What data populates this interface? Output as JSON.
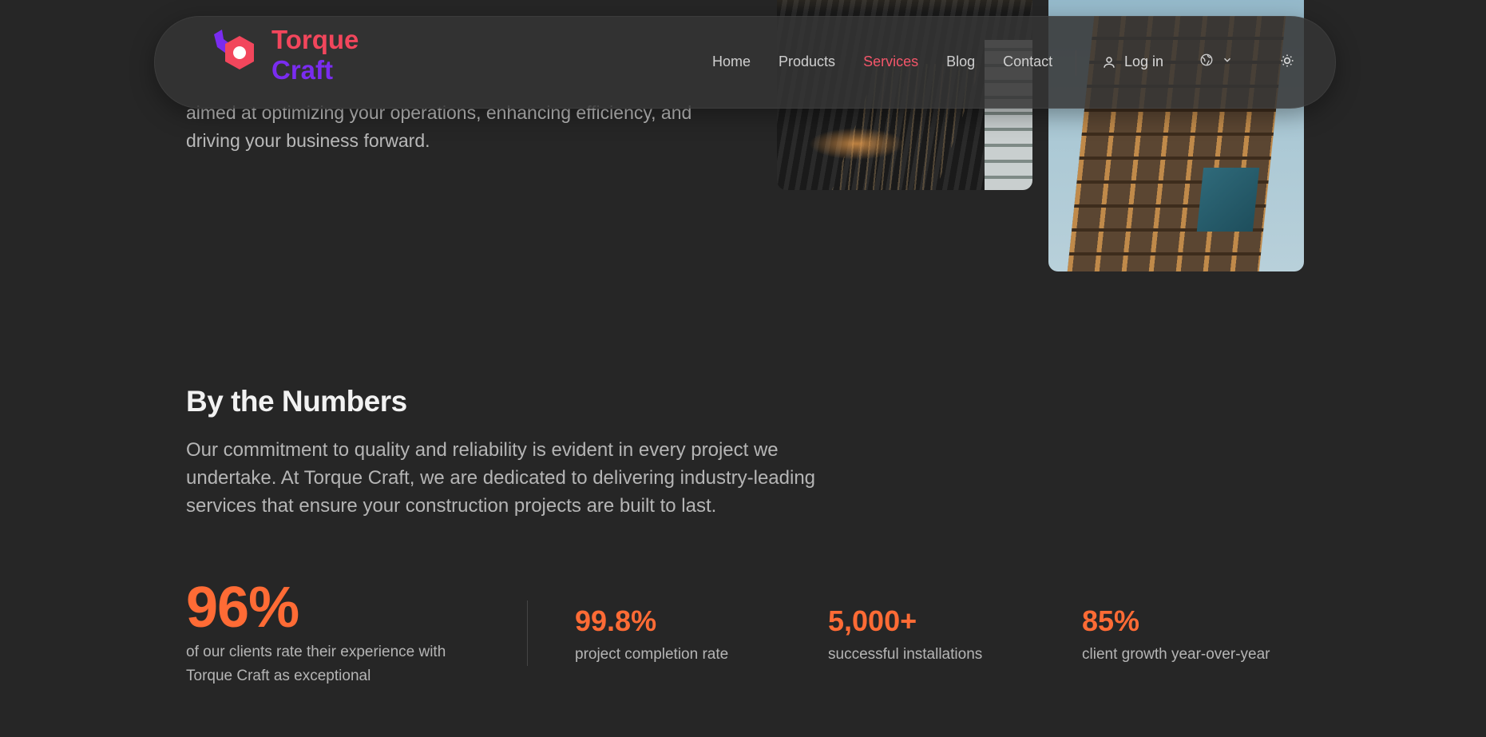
{
  "hero": {
    "description": "aimed at optimizing your operations, enhancing efficiency, and driving your business forward."
  },
  "brand": {
    "name_line1": "Torque",
    "name_line2": "Craft",
    "colors": {
      "primary": "#f2465c",
      "secondary": "#7a2cf0"
    }
  },
  "nav": {
    "links": [
      {
        "label": "Home",
        "active": false
      },
      {
        "label": "Products",
        "active": false
      },
      {
        "label": "Services",
        "active": true
      },
      {
        "label": "Blog",
        "active": false
      },
      {
        "label": "Contact",
        "active": false
      }
    ],
    "login_label": "Log in",
    "language_icon": "globe-icon",
    "theme_icon": "sun-icon"
  },
  "numbers": {
    "title": "By the Numbers",
    "description": "Our commitment to quality and reliability is evident in every project we undertake. At Torque Craft, we are dedicated to delivering industry-leading services that ensure your construction projects are built to last.",
    "featured": {
      "value": "96%",
      "label": "of our clients rate their experience with Torque Craft as exceptional"
    },
    "stats": [
      {
        "value": "99.8%",
        "label": "project completion rate"
      },
      {
        "value": "5,000+",
        "label": "successful installations"
      },
      {
        "value": "85%",
        "label": "client growth year-over-year"
      }
    ],
    "accent_color": "#ff6b35"
  }
}
